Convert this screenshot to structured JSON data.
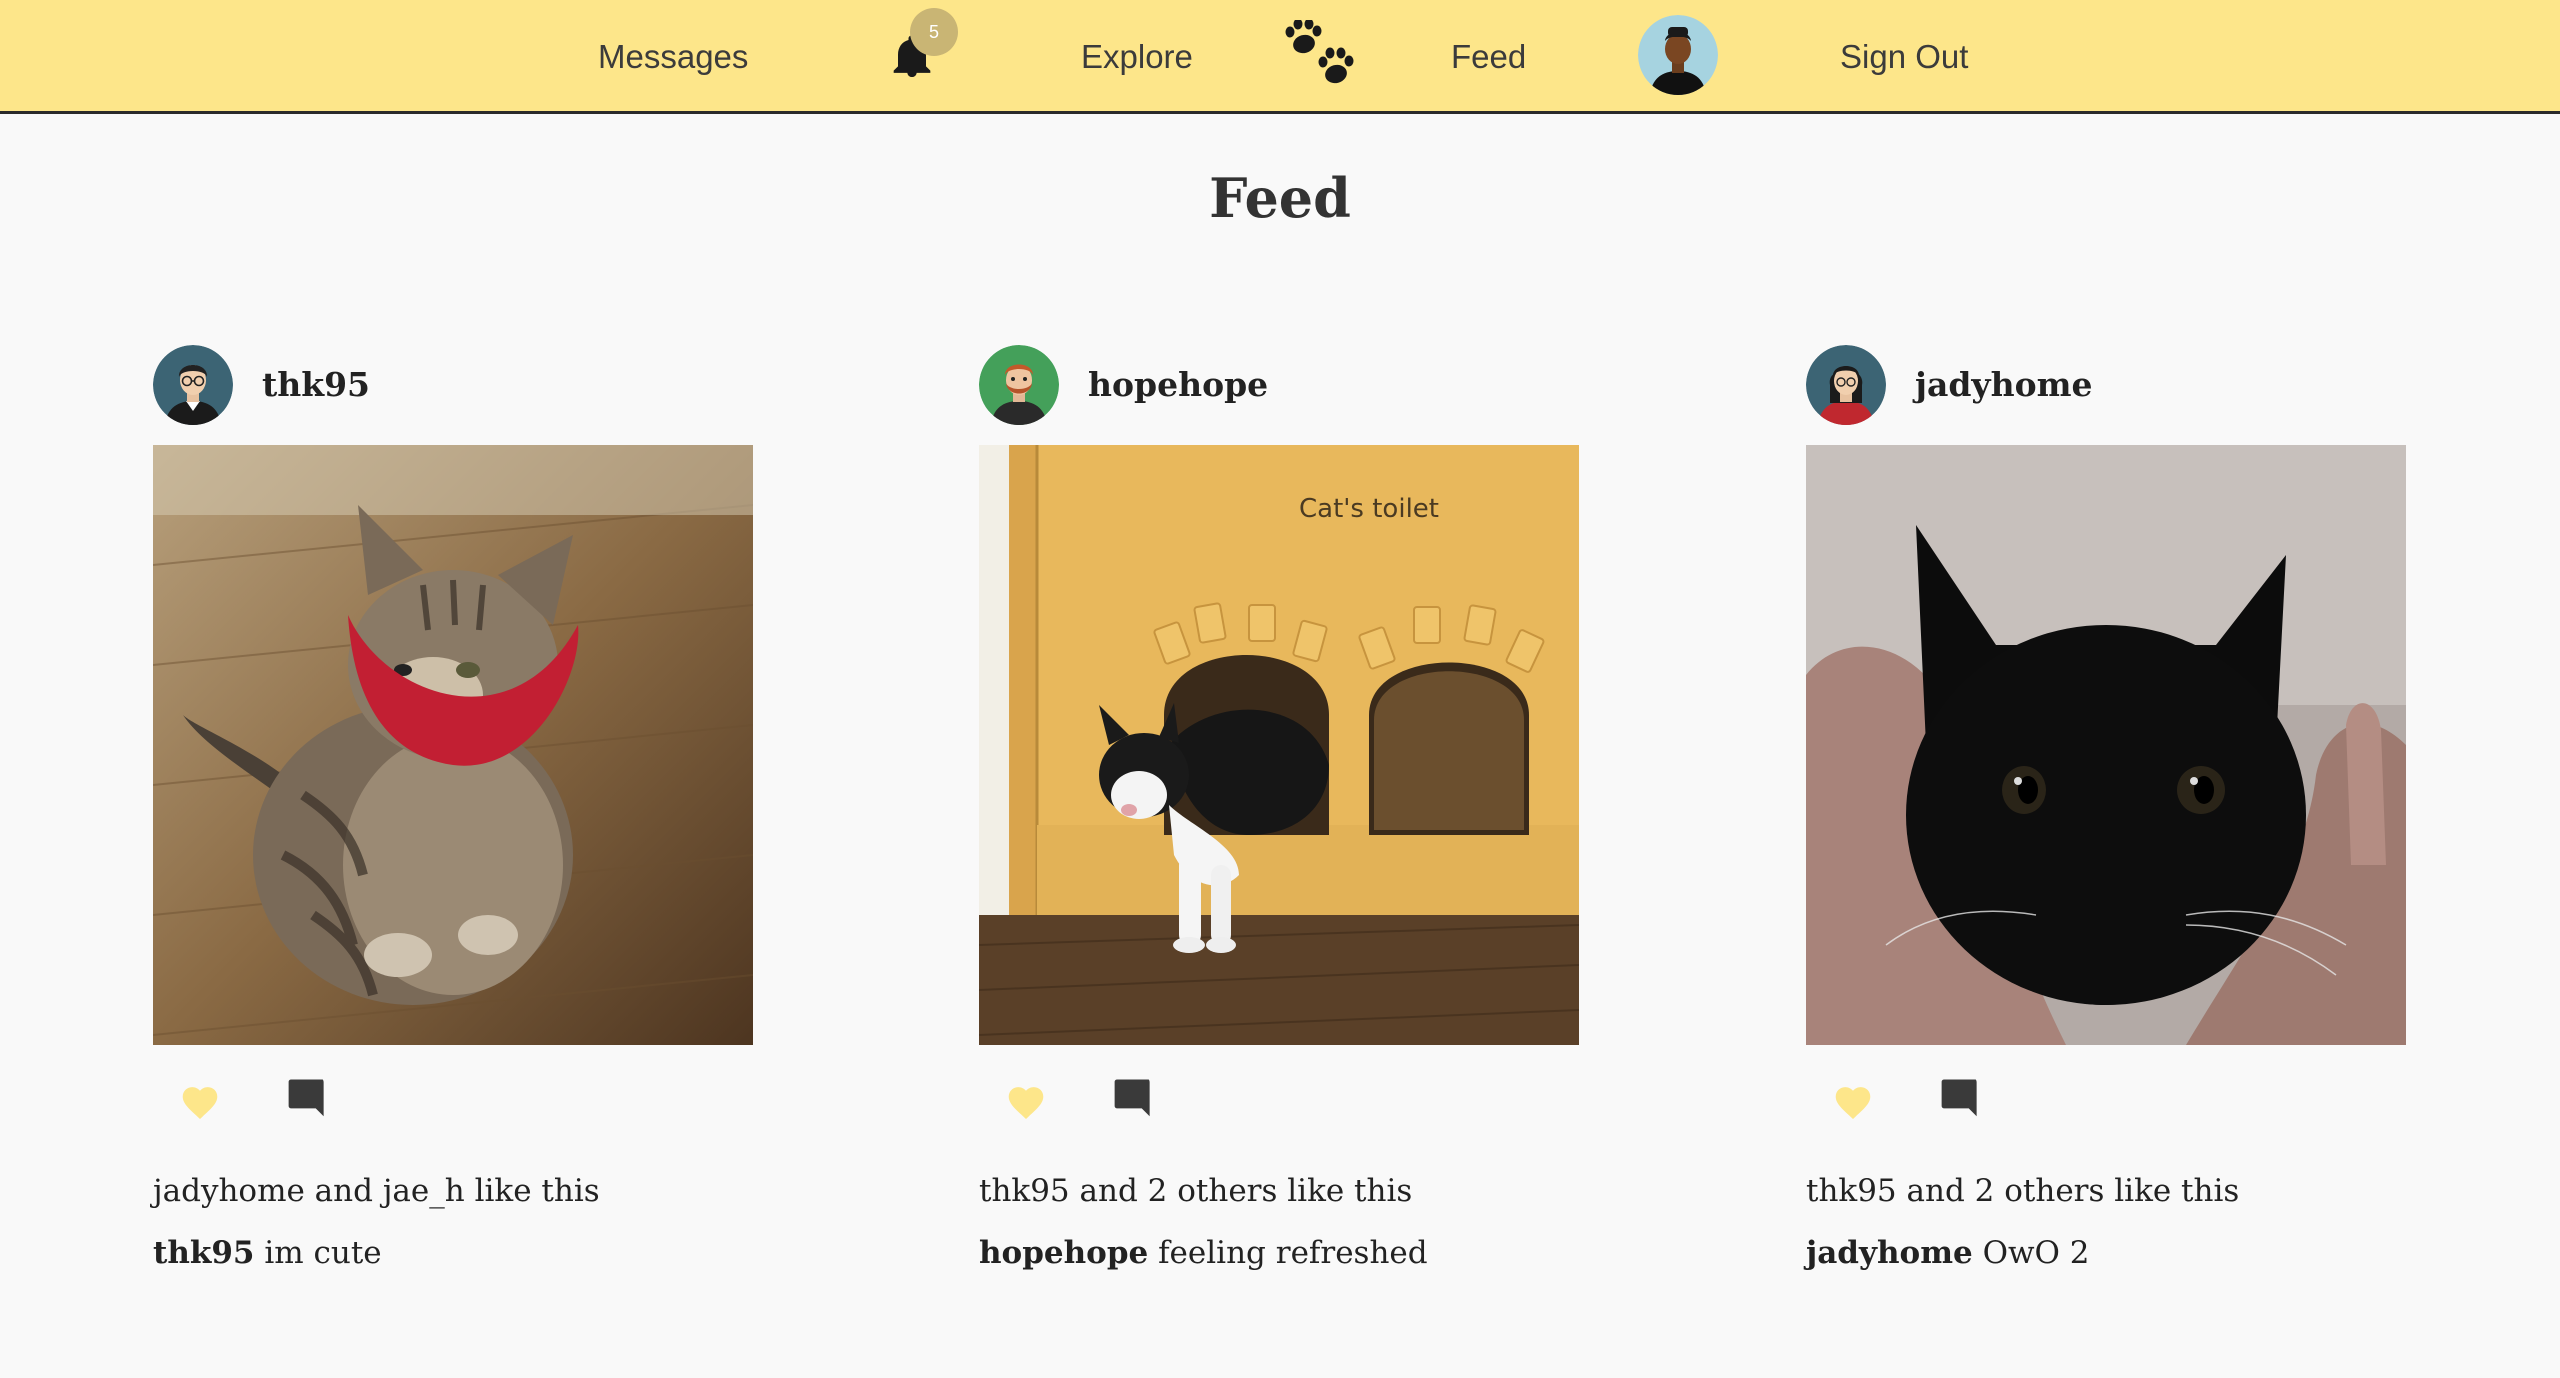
{
  "nav": {
    "messages_label": "Messages",
    "notification_count": "5",
    "explore_label": "Explore",
    "feed_label": "Feed",
    "signout_label": "Sign Out",
    "notification_icon": "bell-icon",
    "paw_icon": "paw-icon",
    "avatar_icon": "user-avatar"
  },
  "colors": {
    "nav_background": "#fde68a",
    "heart": "#fde68a",
    "comment": "#3a3a3a",
    "page_background": "#f9f9f9"
  },
  "page": {
    "title": "Feed"
  },
  "posts": [
    {
      "username": "thk95",
      "likes_text": "jadyhome and jae_h like this",
      "caption_user": "thk95",
      "caption_text": " im cute"
    },
    {
      "username": "hopehope",
      "likes_text": "thk95 and 2 others like this",
      "caption_user": "hopehope",
      "caption_text": " feeling refreshed",
      "photo_sign": "Cat's toilet"
    },
    {
      "username": "jadyhome",
      "likes_text": "thk95 and 2 others like this",
      "caption_user": "jadyhome",
      "caption_text": " OwO 2"
    }
  ]
}
